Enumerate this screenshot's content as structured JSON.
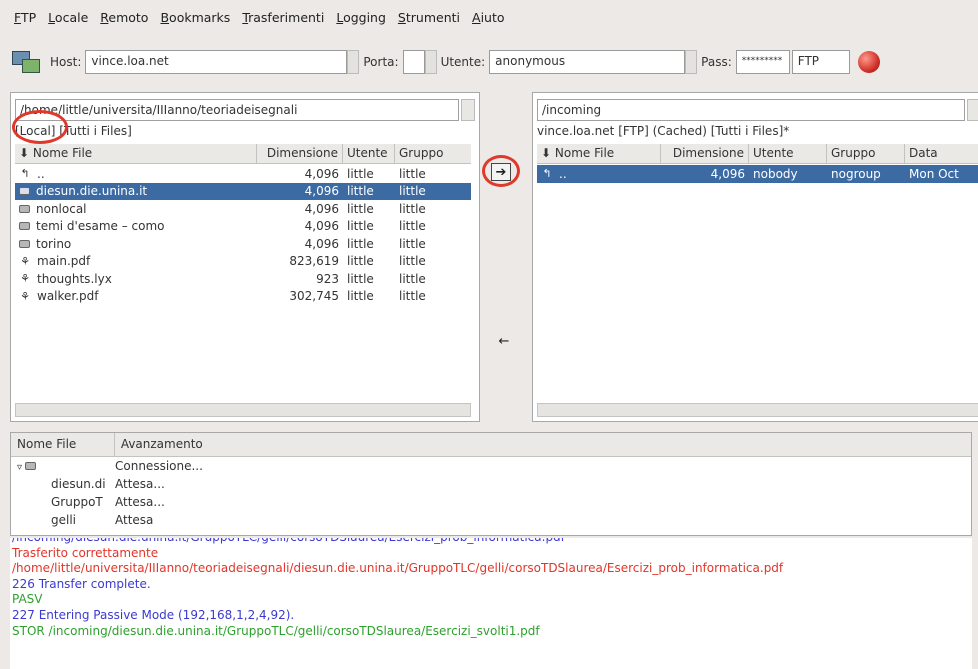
{
  "menu": [
    "FTP",
    "Locale",
    "Remoto",
    "Bookmarks",
    "Trasferimenti",
    "Logging",
    "Strumenti",
    "Aiuto"
  ],
  "toolbar": {
    "host_label": "Host:",
    "host_value": "vince.loa.net",
    "port_label": "Porta:",
    "port_value": "",
    "user_label": "Utente:",
    "user_value": "anonymous",
    "pass_label": "Pass:",
    "pass_value": "*********",
    "protocol": "FTP"
  },
  "local": {
    "path": "/home/little/universita/IIIanno/teoriadeisegnali",
    "status": "[Local] [Tutti i Files]",
    "columns": [
      "Nome File",
      "Dimensione",
      "Utente",
      "Gruppo"
    ],
    "rows": [
      {
        "type": "up",
        "name": "..",
        "size": "4,096",
        "user": "little",
        "group": "little"
      },
      {
        "type": "folder",
        "name": "diesun.die.unina.it",
        "size": "4,096",
        "user": "little",
        "group": "little",
        "selected": true
      },
      {
        "type": "folder",
        "name": "nonlocal",
        "size": "4,096",
        "user": "little",
        "group": "little"
      },
      {
        "type": "folder",
        "name": "temi d'esame – como",
        "size": "4,096",
        "user": "little",
        "group": "little"
      },
      {
        "type": "folder",
        "name": "torino",
        "size": "4,096",
        "user": "little",
        "group": "little"
      },
      {
        "type": "file",
        "name": "main.pdf",
        "size": "823,619",
        "user": "little",
        "group": "little"
      },
      {
        "type": "file",
        "name": "thoughts.lyx",
        "size": "923",
        "user": "little",
        "group": "little"
      },
      {
        "type": "file",
        "name": "walker.pdf",
        "size": "302,745",
        "user": "little",
        "group": "little"
      }
    ]
  },
  "remote": {
    "path": "/incoming",
    "status": "vince.loa.net [FTP] (Cached) [Tutti i Files]*",
    "columns": [
      "Nome File",
      "Dimensione",
      "Utente",
      "Gruppo",
      "Data"
    ],
    "rows": [
      {
        "type": "up",
        "name": "..",
        "size": "4,096",
        "user": "nobody",
        "group": "nogroup",
        "date": "Mon Oct",
        "selected": true
      }
    ]
  },
  "transfers": {
    "columns": [
      "Nome File",
      "Avanzamento"
    ],
    "rows": [
      {
        "name": "",
        "progress": "Connessione...",
        "root": true
      },
      {
        "name": "diesun.di",
        "progress": "Attesa..."
      },
      {
        "name": "GruppoT",
        "progress": "Attesa..."
      },
      {
        "name": "gelli",
        "progress": "Attesa"
      }
    ]
  },
  "log": [
    {
      "text": "/incoming/diesun.die.unina.it/GruppoTLC/gelli/corsoTDSlaurea/Esercizi_prob_informatica.pdf",
      "color": "#3a3ad0"
    },
    {
      "text": "Trasferito correttamente",
      "color": "#e0352a"
    },
    {
      "text": "/home/little/universita/IIIanno/teoriadeisegnali/diesun.die.unina.it/GruppoTLC/gelli/corsoTDSlaurea/Esercizi_prob_informatica.pdf",
      "color": "#e0352a"
    },
    {
      "text": "226 Transfer complete.",
      "color": "#3a3ad0"
    },
    {
      "text": "PASV",
      "color": "#2ea02e"
    },
    {
      "text": "227 Entering Passive Mode (192,168,1,2,4,92).",
      "color": "#3a3ad0"
    },
    {
      "text": "STOR /incoming/diesun.die.unina.it/GruppoTLC/gelli/corsoTDSlaurea/Esercizi_svolti1.pdf",
      "color": "#2ea02e"
    }
  ]
}
